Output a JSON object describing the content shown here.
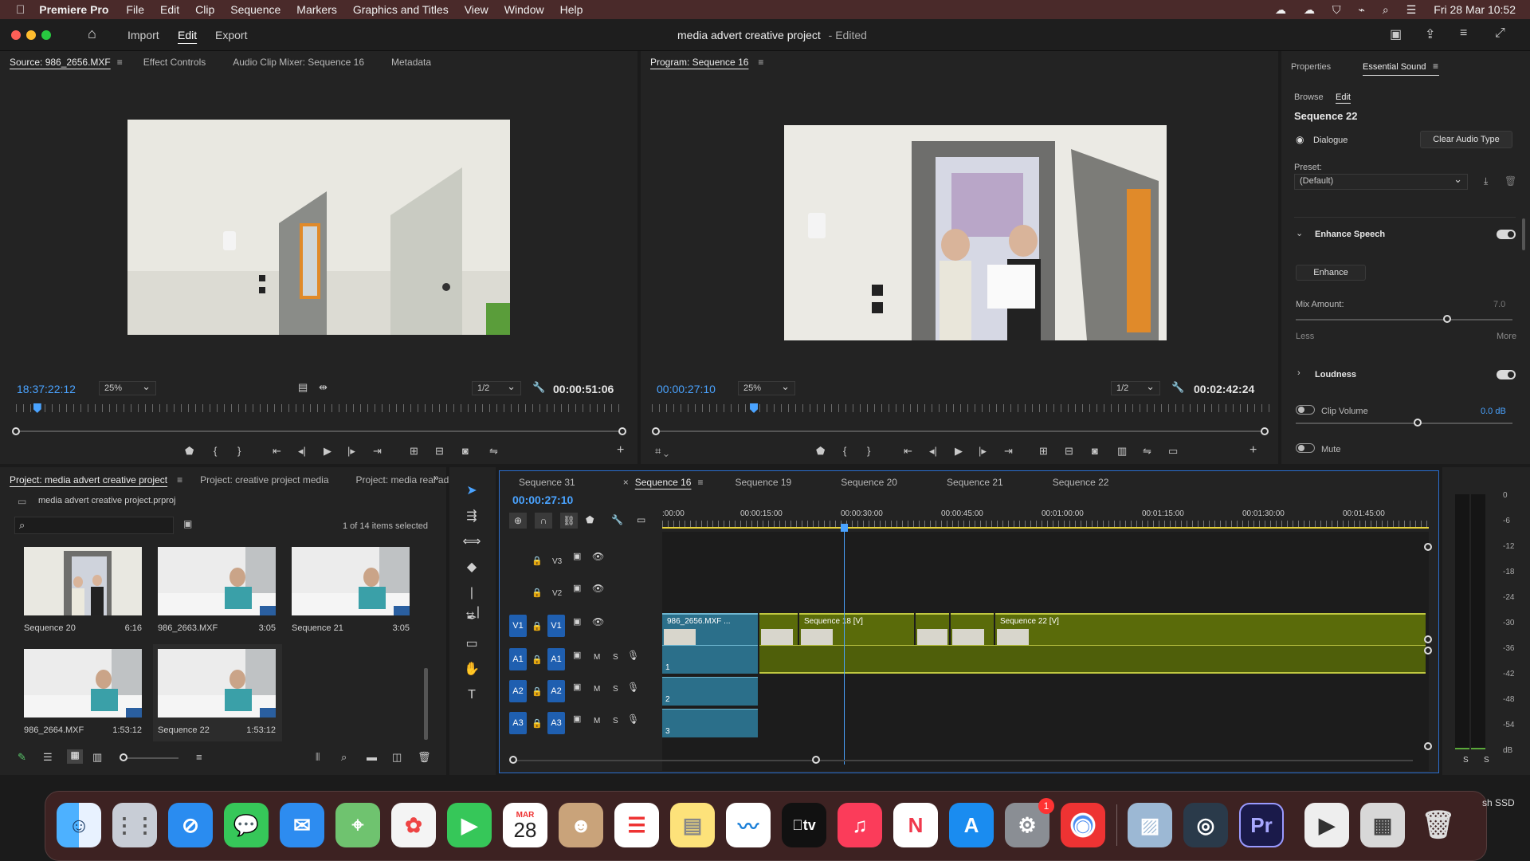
{
  "menubar": {
    "app": "Premiere Pro",
    "items": [
      "File",
      "Edit",
      "Clip",
      "Sequence",
      "Markers",
      "Graphics and Titles",
      "View",
      "Window",
      "Help"
    ],
    "clock": "Fri 28 Mar  10:52"
  },
  "titlebar": {
    "nav": [
      "Import",
      "Edit",
      "Export"
    ],
    "active_nav": "Edit",
    "project_title": "media advert creative project",
    "status": "- Edited"
  },
  "source_monitor": {
    "tabs": [
      "Source: 986_2656.MXF",
      "Effect Controls",
      "Audio Clip Mixer: Sequence 16",
      "Metadata"
    ],
    "timecode": "18:37:22:12",
    "zoom": "25%",
    "resolution": "1/2",
    "duration": "00:00:51:06",
    "playhead_fraction": 0.035
  },
  "program_monitor": {
    "tab": "Program: Sequence 16",
    "timecode": "00:00:27:10",
    "zoom": "25%",
    "resolution": "1/2",
    "duration": "00:02:42:24",
    "playhead_fraction": 0.165
  },
  "essential_sound": {
    "tabs": [
      "Properties",
      "Essential Sound"
    ],
    "subtabs": [
      "Browse",
      "Edit"
    ],
    "sequence": "Sequence 22",
    "type_label": "Dialogue",
    "clear_button": "Clear Audio Type",
    "preset_label": "Preset:",
    "preset_value": "(Default)",
    "enhance_speech": "Enhance Speech",
    "enhance_button": "Enhance",
    "mix_amount_label": "Mix Amount:",
    "mix_amount_value": "7.0",
    "mix_less": "Less",
    "mix_more": "More",
    "loudness": "Loudness",
    "clip_volume": "Clip Volume",
    "clip_volume_value": "0.0 dB",
    "mute": "Mute"
  },
  "project": {
    "tabs": [
      "Project: media advert creative project",
      "Project: creative project media",
      "Project: media real ad"
    ],
    "file": "media advert creative project.prproj",
    "selection_info": "1 of 14 items selected",
    "search_placeholder": "",
    "items": [
      {
        "name": "Sequence 20",
        "duration": "6:16"
      },
      {
        "name": "986_2663.MXF",
        "duration": "3:05"
      },
      {
        "name": "Sequence 21",
        "duration": "3:05"
      },
      {
        "name": "986_2664.MXF",
        "duration": "1:53:12"
      },
      {
        "name": "Sequence 22",
        "duration": "1:53:12"
      }
    ]
  },
  "timeline": {
    "tabs": [
      "Sequence 31",
      "Sequence 16",
      "Sequence 19",
      "Sequence 20",
      "Sequence 21",
      "Sequence 22"
    ],
    "active_tab": "Sequence 16",
    "timecode": "00:00:27:10",
    "ruler_labels": [
      ":00:00",
      "00:00:15:00",
      "00:00:30:00",
      "00:00:45:00",
      "00:01:00:00",
      "00:01:15:00",
      "00:01:30:00",
      "00:01:45:00"
    ],
    "video_tracks": [
      "V3",
      "V2",
      "V1"
    ],
    "audio_tracks": [
      "A1",
      "A2",
      "A3"
    ],
    "clips": {
      "v1_a": "986_2656.MXF ...",
      "v1_b": "Sequence 18 [V]",
      "v1_c": "Sequence 22 [V]"
    },
    "audio_numbers": [
      "1",
      "2",
      "3"
    ],
    "mute_label": "M",
    "solo_label": "S"
  },
  "meter": {
    "scale": [
      "0",
      "-6",
      "-12",
      "-18",
      "-24",
      "-30",
      "-36",
      "-42",
      "-48",
      "-54",
      "dB"
    ],
    "solo": [
      "S",
      "S"
    ]
  },
  "dock": {
    "calendar_month": "MAR",
    "calendar_day": "28",
    "settings_badge": "1",
    "premiere_label": "Pr",
    "tv_label": "tv",
    "ssd_label": "sh SSD"
  },
  "colors": {
    "accent_blue": "#4aa3ff",
    "clip_green": "#5a6b0a",
    "clip_teal": "#2b6f8a",
    "track_blue": "#1f5fb0"
  }
}
